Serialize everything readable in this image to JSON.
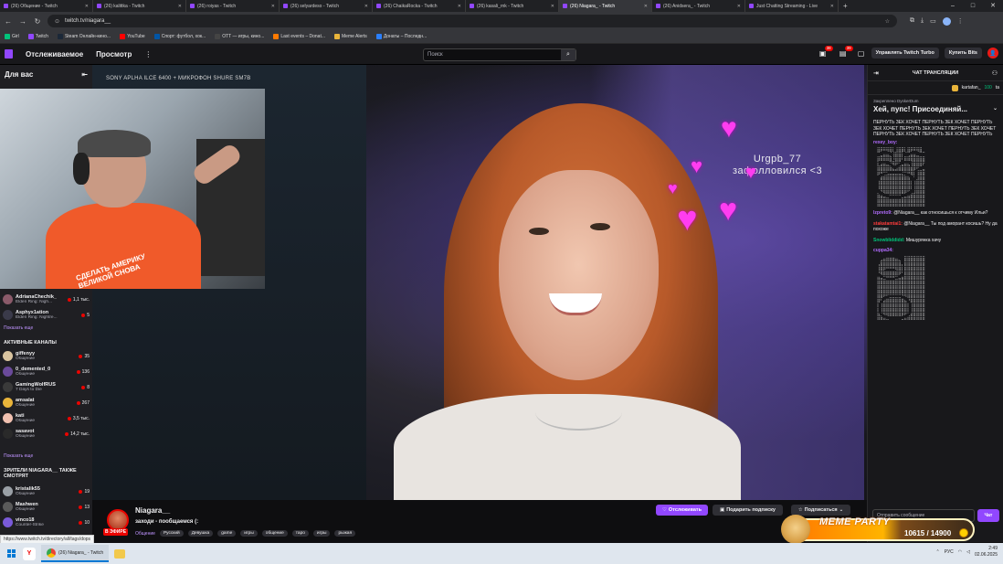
{
  "browser": {
    "tabs": [
      {
        "label": "(26) Общение - Twitch",
        "color": "#9147ff"
      },
      {
        "label": "(26) kalittka - Twitch",
        "color": "#9147ff"
      },
      {
        "label": "(26) roiyas - Twitch",
        "color": "#9147ff"
      },
      {
        "label": "(26) selyardeso - Twitch",
        "color": "#9147ff"
      },
      {
        "label": "(26) ChaikaRocka - Twitch",
        "color": "#9147ff"
      },
      {
        "label": "(26) kasali_rnk - Twitch",
        "color": "#9147ff"
      },
      {
        "label": "(26) Niagara_ - Twitch",
        "color": "#9147ff",
        "active": true
      },
      {
        "label": "(26) Anidsera_ - Twitch",
        "color": "#9147ff"
      },
      {
        "label": "Just Chatting Streaming - Live",
        "color": "#9147ff"
      }
    ],
    "new_tab": "+",
    "url": "twitch.tv/niagara__",
    "bookmarks": [
      {
        "label": "Girl",
        "color": "#00c37a"
      },
      {
        "label": "Twitch",
        "color": "#9147ff"
      },
      {
        "label": "Steam Онлайн-кино...",
        "color": "#1b2838"
      },
      {
        "label": "YouTube",
        "color": "#ff0000"
      },
      {
        "label": "Спорт: футбол, хок...",
        "color": "#0055a5"
      },
      {
        "label": "OTT — игры, кино...",
        "color": "#444444"
      },
      {
        "label": "Last events – Donat...",
        "color": "#ff7a00"
      },
      {
        "label": "Meme Alerts",
        "color": "#e9b43a"
      },
      {
        "label": "Донаты – Последн...",
        "color": "#2a7fff"
      }
    ]
  },
  "twitch": {
    "nav": {
      "following": "Отслеживаемое",
      "browse": "Просмотр",
      "more": "⋮"
    },
    "search": {
      "placeholder": "Поиск"
    },
    "notifications": {
      "count1": "38",
      "count2": "39"
    },
    "turbo_label": "Управлять Twitch Turbo",
    "bits_label": "Купить Bits"
  },
  "sidebar": {
    "title": "Для вас",
    "followed": [
      {
        "name": "AdrianaChechik_",
        "game": "Elden Ring: Nigh...",
        "viewers": "1,1 тыс.",
        "color": "#8a5a6a"
      },
      {
        "name": "Asphyx1ation",
        "game": "Elden Ring: Nightre...",
        "viewers": "5",
        "color": "#3a3a4a"
      }
    ],
    "show_more": "Показать еще",
    "active_title": "АКТИВНЫЕ КАНАЛЫ",
    "active": [
      {
        "name": "giffenyy",
        "game": "Общение",
        "viewers": "35",
        "color": "#d9c4a0"
      },
      {
        "name": "0_demented_0",
        "game": "Общение",
        "viewers": "136",
        "color": "#6a4a9a"
      },
      {
        "name": "GamingWolfRUS",
        "game": "7 Days to Die",
        "viewers": "8",
        "color": "#3a3a3a"
      },
      {
        "name": "amsalat",
        "game": "Общение",
        "viewers": "267",
        "color": "#e9b43a"
      },
      {
        "name": "kati",
        "game": "Общение",
        "viewers": "3,5 тыс.",
        "color": "#f0c0b0"
      },
      {
        "name": "sasavot",
        "game": "Общение",
        "viewers": "14,2 тыс.",
        "color": "#2a2a2a"
      }
    ],
    "show_more2": "Показать еще",
    "viewers_title": "ЗРИТЕЛИ NIAGARA__ ТАКЖЕ СМОТРЯТ",
    "also": [
      {
        "name": "kristalik55",
        "game": "Общение",
        "viewers": "19",
        "color": "#9aa0a6"
      },
      {
        "name": "Mashwen",
        "game": "Общение",
        "viewers": "13",
        "color": "#5a5a5a"
      },
      {
        "name": "vinco18",
        "game": "Counter-Strike",
        "viewers": "10",
        "color": "#7a5ad9"
      }
    ]
  },
  "video": {
    "cam_label": "SONY APLHA ILCE 6400 + МИКРОФОН SHURE SM7B",
    "overlay_user": "Urgpb_77",
    "overlay_text": "зафолловился <3",
    "pip_text": "СДЕЛАТЬ АМЕРИКУ ВЕЛИКОЙ СНОВА"
  },
  "stream": {
    "name": "Niagara__",
    "title": "заходи - пообщаемся (:",
    "live": "В ЭФИРЕ",
    "category": "Общение",
    "tags": [
      "Русский",
      "Девушка",
      "game",
      "игры",
      "общение",
      "таро",
      "игры",
      "рыжая"
    ],
    "follow": "Отслеживать",
    "gift": "Подарить подписку",
    "subscribe": "Подписаться"
  },
  "chat": {
    "title": "ЧАТ ТРАНСЛЯЦИИ",
    "top_user": "kartafan_",
    "top_points": "100",
    "top_extra": "ta",
    "pinned_by": "Закреплено DyskerDum",
    "pinned_text": "Хей, пупс! Присоединяй...",
    "msg_spam": "ПЕРНУТЬ ЗЕК ХОЧЕТ ПЕРНУТЬ ЗЕК ХОЧЕТ ПЕРНУТЬ ЗЕК ХОЧЕТ ПЕРНУТЬ ЗЕК ХОЧЕТ ПЕРНУТЬ ЗЕК ХОЧЕТ ПЕРНУТЬ ЗЕК ХОЧЕТ ПЕРНУТЬ ЗЕК ХОЧЕТ ПЕРНУТЬ",
    "messages": [
      {
        "user": "rexey_boy:",
        "color": "#b26cff",
        "text": ""
      },
      {
        "user": "lzpreto9:",
        "color": "#b26cff",
        "text": "@Niagara__ как относишься к отчиму Ильи?"
      },
      {
        "user": "stakatamtai1:",
        "color": "#ff3c3c",
        "text": "@Niagara__ Ты под аморант косишь? Ну да похоже"
      },
      {
        "user": "Snowbliddidd:",
        "color": "#00c37a",
        "text": "Мишурянка хачу"
      },
      {
        "user": "cuppa34:",
        "color": "#b26cff",
        "text": ""
      }
    ],
    "input_placeholder": "Отправить сообщение",
    "send": "Чат"
  },
  "meme": {
    "title": "MEME PARTY",
    "count": "10615 / 14900"
  },
  "status_url": "https://www.twitch.tv/directory/all/tags/dops",
  "taskbar": {
    "task_label": "(26) Niagara_ - Twitch",
    "lang": "РУС",
    "time": "2:49",
    "date": "02.06.2025"
  }
}
